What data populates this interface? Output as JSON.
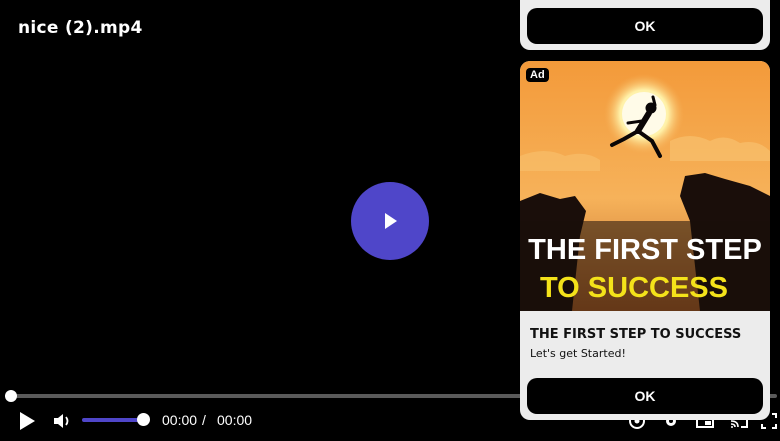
{
  "video": {
    "title": "nice (2).mp4",
    "progress": 0,
    "volume": 1
  },
  "controls": {
    "current_time": "00:00",
    "separator": "/",
    "duration": "00:00",
    "icons": [
      "play-icon",
      "volume-icon",
      "chromecast-icon",
      "settings-icon",
      "pip-icon",
      "cast-icon",
      "fullscreen-icon"
    ]
  },
  "ad": {
    "top_ok_label": "OK",
    "badge": "Ad",
    "image_text_line1": "THE FIRST STEP",
    "image_text_line2": "TO SUCCESS",
    "headline": "THE FIRST STEP TO SUCCESS",
    "subtext": "Let's get Started!",
    "ok_label": "OK"
  },
  "colors": {
    "accent": "#4f46c9",
    "background": "#000000",
    "ad_panel": "#ececec",
    "ad_text_yellow": "#f4e21a"
  }
}
